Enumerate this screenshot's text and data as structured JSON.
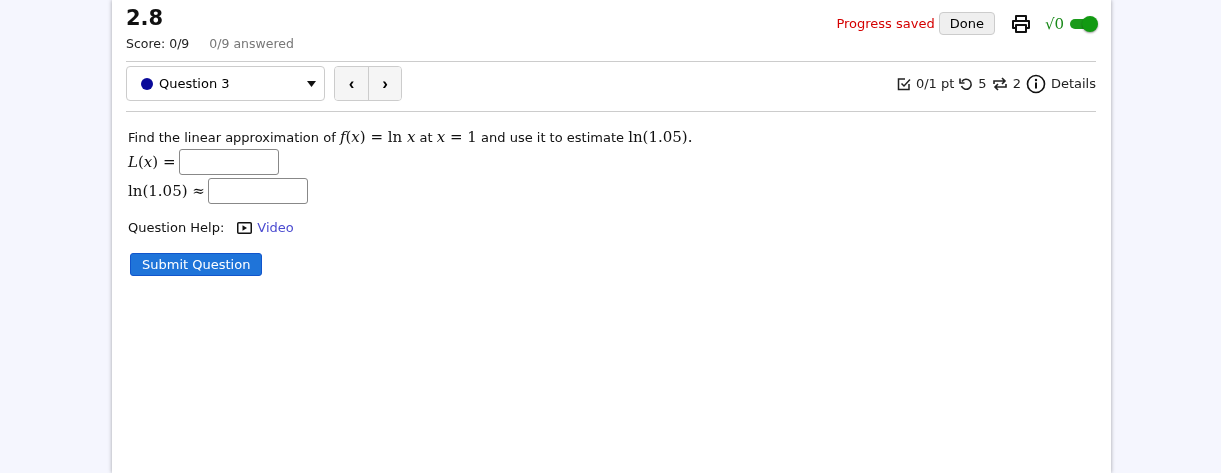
{
  "header": {
    "title": "2.8",
    "score": "Score: 0/9",
    "answered": "0/9 answered",
    "progress": "Progress saved",
    "done_button": "Done",
    "math_toggle": {
      "label": "√0",
      "on": true
    }
  },
  "question_nav": {
    "selector": {
      "label": "Question 3",
      "color": "#0a0a9a"
    },
    "prev": "‹",
    "next": "›"
  },
  "question_info": {
    "points": "0/1 pt",
    "attempts": "5",
    "retries": "2",
    "details": "Details"
  },
  "question": {
    "prompt": [
      {
        "kind": "text",
        "text": "Find the linear approximation of"
      },
      {
        "kind": "math",
        "text": "*f*(*x*) = ln *x*"
      },
      {
        "kind": "text",
        "text": "at"
      },
      {
        "kind": "math",
        "text": "*x* = 1"
      },
      {
        "kind": "text",
        "text": "and use it to estimate"
      },
      {
        "kind": "math",
        "text": "ln(1.05)."
      }
    ],
    "answers": [
      {
        "label": "*L*(*x*) ="
      },
      {
        "label": "ln(1.05) ≈"
      }
    ],
    "help_label": "Question Help:",
    "help_link": "Video",
    "submit": "Submit Question"
  }
}
